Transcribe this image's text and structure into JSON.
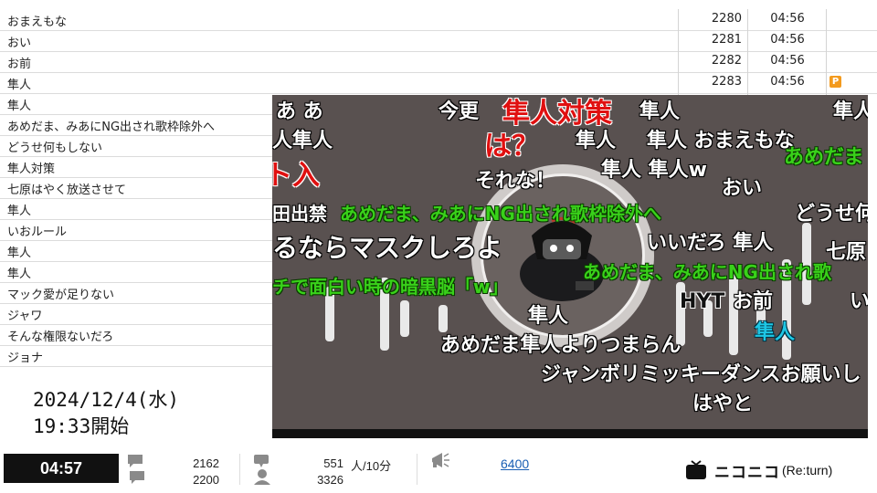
{
  "comment_list": {
    "rows": [
      {
        "text": "おまえもな",
        "number": "2280",
        "time": "04:56",
        "badge": ""
      },
      {
        "text": "おい",
        "number": "2281",
        "time": "04:56",
        "badge": ""
      },
      {
        "text": "お前",
        "number": "2282",
        "time": "04:56",
        "badge": ""
      },
      {
        "text": "隼人",
        "number": "2283",
        "time": "04:56",
        "badge": "P"
      },
      {
        "text": "隼人"
      },
      {
        "text": "あめだま、みあにNG出され歌枠除外へ"
      },
      {
        "text": "どうせ何もしない"
      },
      {
        "text": "隼人対策"
      },
      {
        "text": "七原はやく放送させて"
      },
      {
        "text": "隼人"
      },
      {
        "text": "いおルール"
      },
      {
        "text": "隼人"
      },
      {
        "text": "隼人"
      },
      {
        "text": "マック愛が足りない"
      },
      {
        "text": "ジャワ"
      },
      {
        "text": "そんな権限ないだろ"
      },
      {
        "text": "ジョナ"
      }
    ]
  },
  "video": {
    "overlay_comments": [
      {
        "text": "あ あ",
        "color": "w"
      },
      {
        "text": "今更",
        "color": "w"
      },
      {
        "text": "隼人対策",
        "color": "r"
      },
      {
        "text": "隼人",
        "color": "w"
      },
      {
        "text": "隼人",
        "color": "w"
      },
      {
        "text": "人隼人",
        "color": "w"
      },
      {
        "text": "は？",
        "color": "r"
      },
      {
        "text": "隼人",
        "color": "w"
      },
      {
        "text": "隼人 おまえもな",
        "color": "w"
      },
      {
        "text": "あめだま",
        "color": "g"
      },
      {
        "text": "ト入",
        "color": "r"
      },
      {
        "text": "それな！",
        "color": "w"
      },
      {
        "text": "隼人 隼人w",
        "color": "w"
      },
      {
        "text": "おい",
        "color": "w"
      },
      {
        "text": "田出禁",
        "color": "w"
      },
      {
        "text": "あめだま、みあにNG出され歌枠除外へ",
        "color": "g"
      },
      {
        "text": "どうせ何",
        "color": "w"
      },
      {
        "text": "るならマスクしろよ",
        "color": "w"
      },
      {
        "text": "いいだろ 隼人",
        "color": "w"
      },
      {
        "text": "七原",
        "color": "w"
      },
      {
        "text": "チで面白い時の暗黒脳「w」",
        "color": "g"
      },
      {
        "text": "あめだま、みあにNG出され歌",
        "color": "g"
      },
      {
        "text": "HYT",
        "color": "k"
      },
      {
        "text": "お前",
        "color": "w"
      },
      {
        "text": "い",
        "color": "w"
      },
      {
        "text": "隼人",
        "color": "w"
      },
      {
        "text": "隼人",
        "color": "cy"
      },
      {
        "text": "あめだま隼人よりつまらん",
        "color": "w"
      },
      {
        "text": "ジャンボリミッキーダンスお願いし",
        "color": "w"
      },
      {
        "text": "はやと",
        "color": "w"
      }
    ]
  },
  "broadcast": {
    "date": "2024/12/4(水)",
    "start": "19:33開始"
  },
  "statusbar": {
    "elapsed": "04:57",
    "comments_top": "2162",
    "comments_bottom": "2200",
    "viewers_rate": "551",
    "viewers_unit": "人/10分",
    "viewers_total": "3326",
    "ad_points": "6400",
    "brand": "ニコニコ",
    "brand_suffix": "(Re:turn)"
  },
  "colors": {
    "video_bg": "#595150",
    "comment_green": "#39d11a",
    "comment_red": "#e01010",
    "comment_cyan": "#1ec8e6",
    "premium_badge": "#f39a1d",
    "link_blue": "#1a5fb4"
  },
  "icons": [
    "comment-icon",
    "viewer-icon",
    "megaphone-icon",
    "nicotv-icon"
  ]
}
